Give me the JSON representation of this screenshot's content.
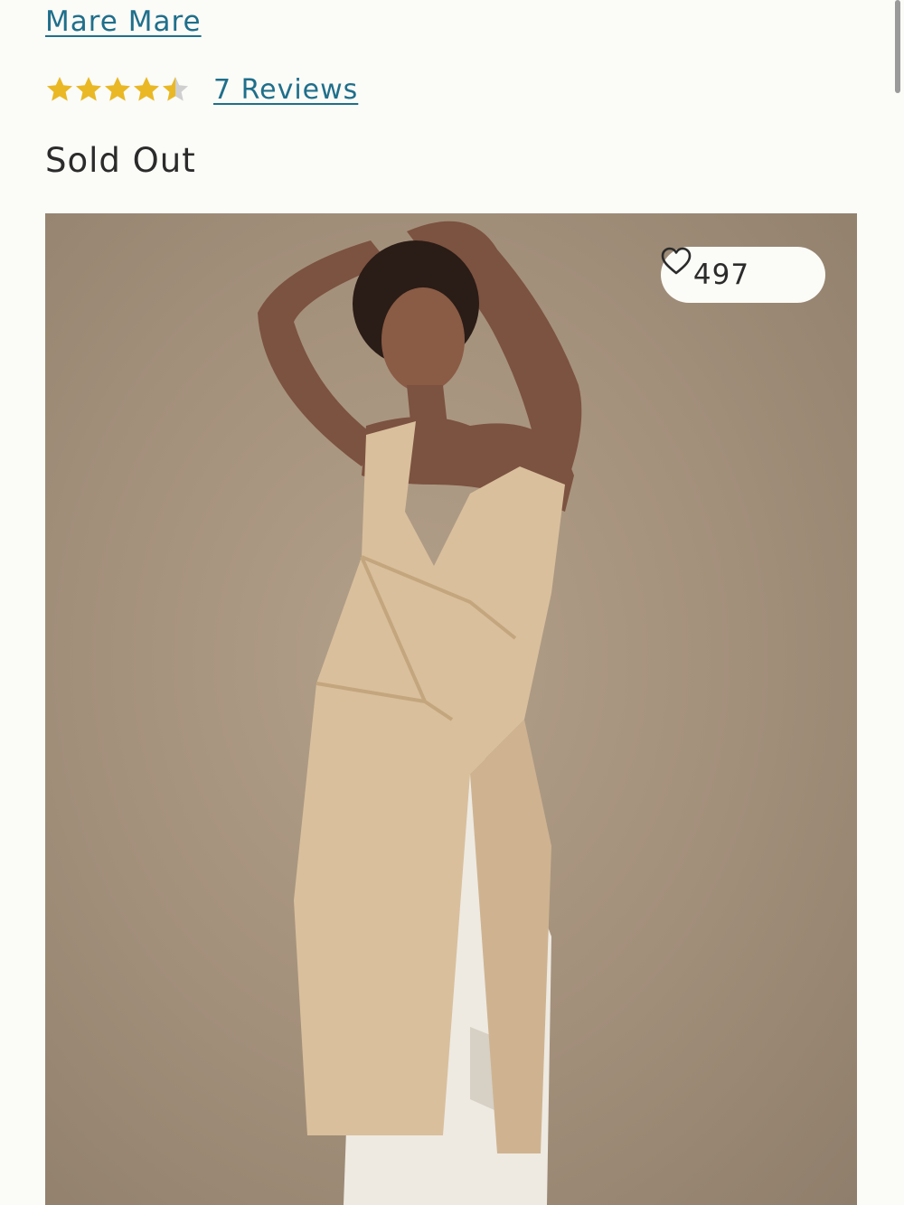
{
  "product": {
    "brand": "Mare Mare",
    "rating": 4.5,
    "reviews_label": "7 Reviews",
    "stock_status": "Sold Out",
    "likes": "497"
  },
  "colors": {
    "link": "#1f6f8b",
    "star_filled": "#e9b824",
    "star_empty": "#cfcfcf",
    "background": "#fbfbf7"
  },
  "icons": {
    "star": "star-icon",
    "heart": "heart-outline-icon"
  }
}
